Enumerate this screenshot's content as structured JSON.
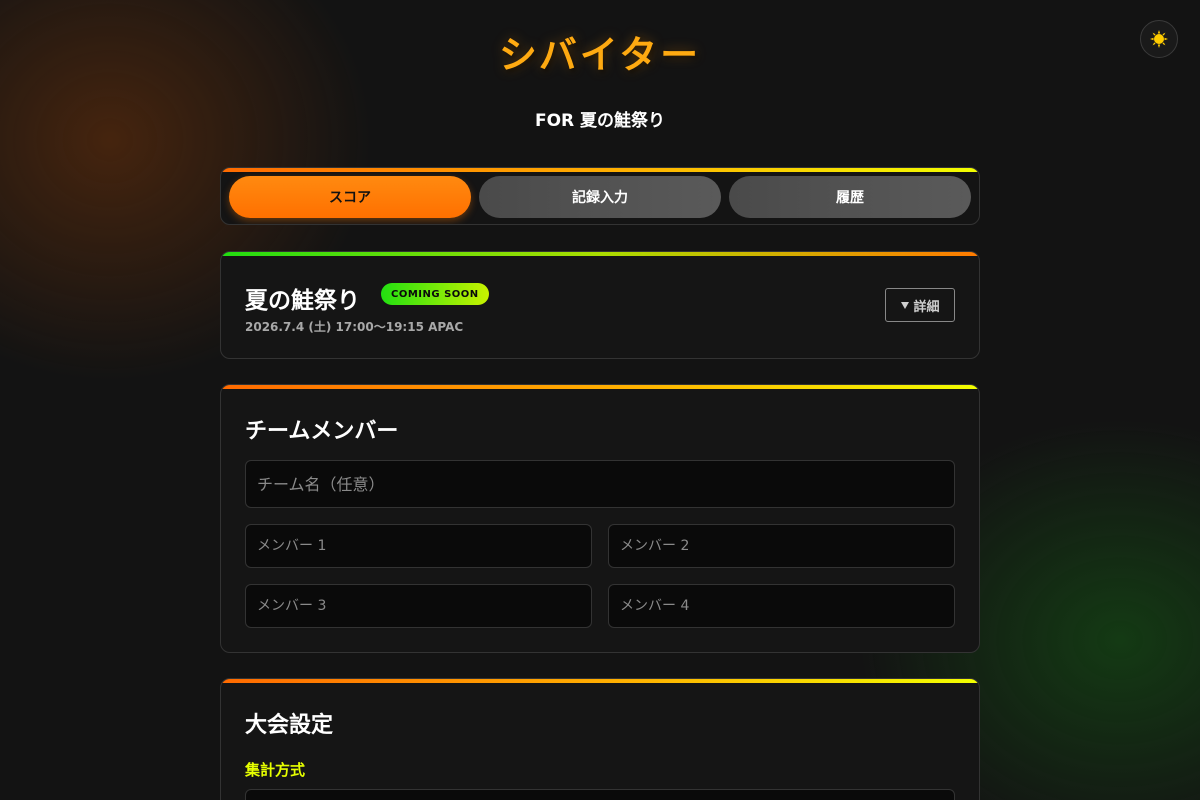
{
  "app": {
    "title": "シバイター",
    "subtitle": "FOR 夏の鮭祭り",
    "theme_icon": "sun-icon",
    "accent": "#ff7a00",
    "highlight": "#e6ff00"
  },
  "tabs": [
    {
      "label": "スコア",
      "active": true
    },
    {
      "label": "記録入力",
      "active": false
    },
    {
      "label": "履歴",
      "active": false
    }
  ],
  "event": {
    "name": "夏の鮭祭り",
    "badge": "COMING SOON",
    "date": "2026.7.4 (土) 17:00〜19:15 APAC",
    "detail_label": "詳細",
    "detail_icon": "triangle-down-icon"
  },
  "team": {
    "heading": "チームメンバー",
    "team_name_placeholder": "チーム名（任意）",
    "members": [
      {
        "placeholder": "メンバー 1"
      },
      {
        "placeholder": "メンバー 2"
      },
      {
        "placeholder": "メンバー 3"
      },
      {
        "placeholder": "メンバー 4"
      }
    ]
  },
  "settings": {
    "heading": "大会設定",
    "aggregation_label": "集計方式"
  }
}
